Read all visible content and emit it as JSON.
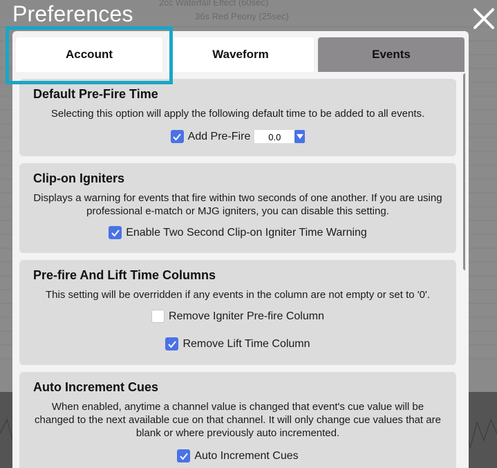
{
  "window": {
    "title": "Preferences"
  },
  "background": {
    "line1": "2cc Waterfall Effect (60sec)",
    "line2": "36s Red Peony (25sec)"
  },
  "tabs": [
    {
      "label": "Account",
      "active": true
    },
    {
      "label": "Waveform",
      "active": false
    },
    {
      "label": "Events",
      "active": false
    }
  ],
  "sections": {
    "prefire": {
      "title": "Default Pre-Fire Time",
      "description": "Selecting this option will apply the following default time to be added to all events.",
      "option_label": "Add Pre-Fire",
      "option_checked": true,
      "value": "0.0"
    },
    "clipon": {
      "title": "Clip-on Igniters",
      "description": "Displays a warning for events that fire within two seconds of one another. If you are using professional e-match or MJG igniters, you can disable this setting.",
      "option_label": "Enable Two Second Clip-on Igniter Time Warning",
      "option_checked": true
    },
    "columns": {
      "title": "Pre-fire And Lift Time Columns",
      "description": "This setting will be overridden if any events in the column are not empty or set to '0'.",
      "option1_label": "Remove Igniter Pre-fire Column",
      "option1_checked": false,
      "option2_label": "Remove Lift Time Column",
      "option2_checked": true
    },
    "autoinc": {
      "title": "Auto Increment Cues",
      "description": "When enabled, anytime a channel value is changed that event's cue value will be changed to the next available cue on that channel. It will only change cue values that are blank or where previously auto incremented.",
      "option_label": "Auto Increment Cues",
      "option_checked": true
    }
  },
  "colors": {
    "accent": "#4a72e6",
    "highlight": "#19a6c6",
    "section_bg": "#dcdcdc"
  }
}
